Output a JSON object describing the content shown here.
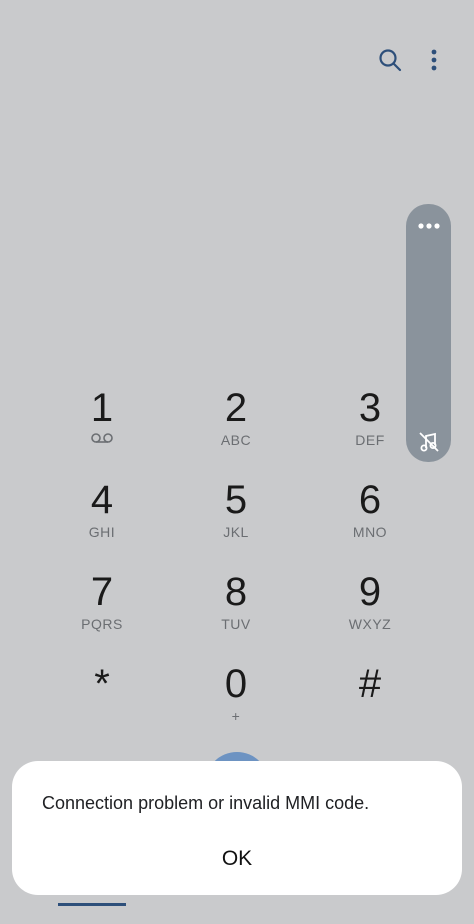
{
  "header": {
    "search_icon": "search-icon",
    "more_icon": "more-vertical-icon"
  },
  "side_panel": {
    "menu_icon": "more-horizontal-icon",
    "mute_icon": "muted-note-icon"
  },
  "keypad": {
    "keys": [
      {
        "digit": "1",
        "letters": ""
      },
      {
        "digit": "2",
        "letters": "ABC"
      },
      {
        "digit": "3",
        "letters": "DEF"
      },
      {
        "digit": "4",
        "letters": "GHI"
      },
      {
        "digit": "5",
        "letters": "JKL"
      },
      {
        "digit": "6",
        "letters": "MNO"
      },
      {
        "digit": "7",
        "letters": "PQRS"
      },
      {
        "digit": "8",
        "letters": "TUV"
      },
      {
        "digit": "9",
        "letters": "WXYZ"
      },
      {
        "digit": "*",
        "letters": ""
      },
      {
        "digit": "0",
        "letters": "+"
      },
      {
        "digit": "#",
        "letters": ""
      }
    ]
  },
  "dialog": {
    "message": "Connection problem or invalid MMI code.",
    "ok_label": "OK"
  },
  "colors": {
    "background": "#c9cacc",
    "accent": "#2d4f7a",
    "call_button": "#6d93c2",
    "side_panel": "#8a939c"
  }
}
